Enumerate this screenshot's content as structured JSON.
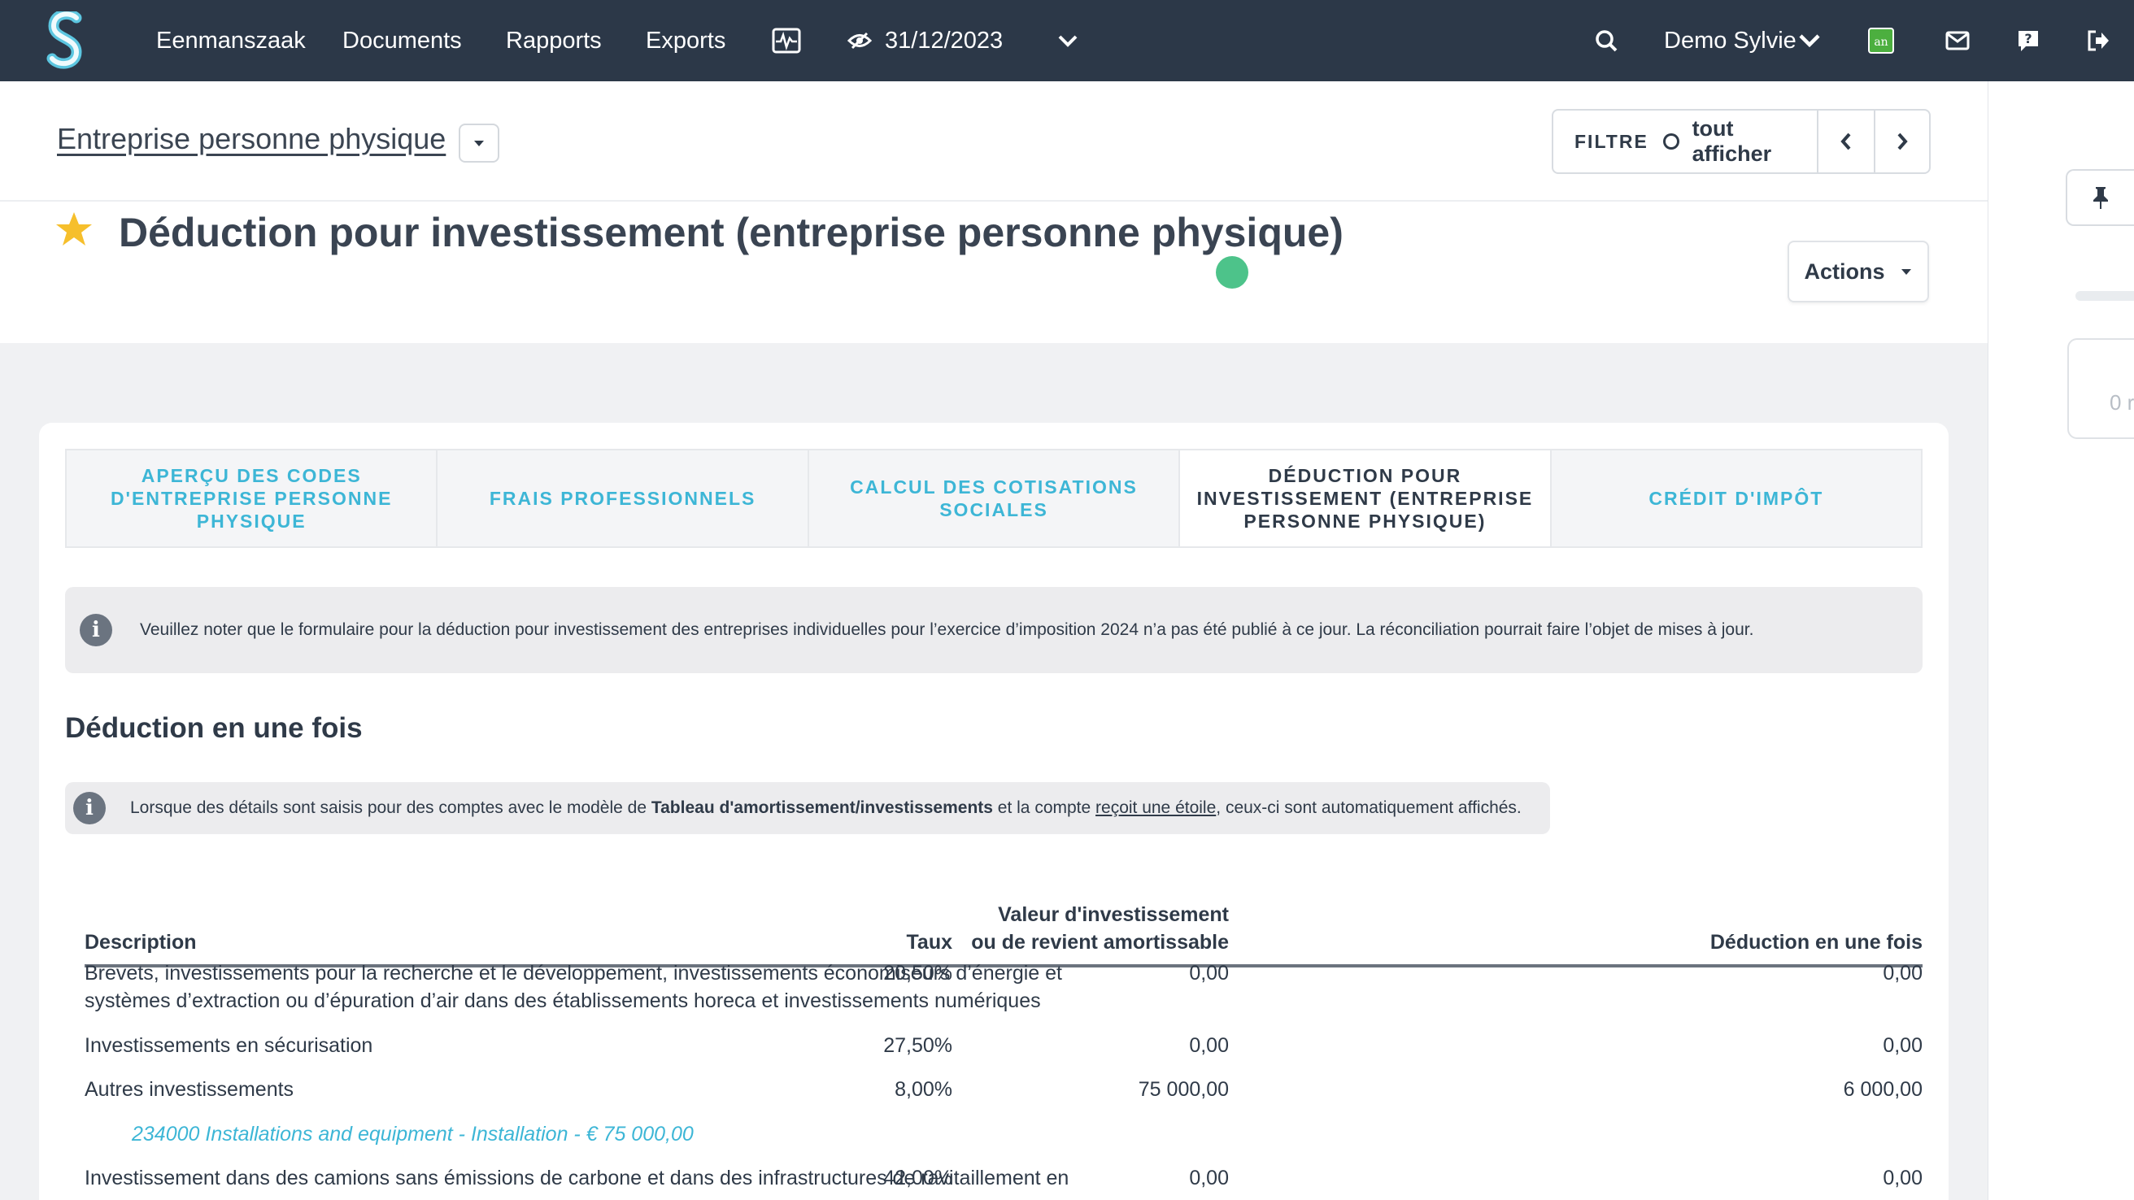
{
  "nav": {
    "items": [
      "Eenmanszaak",
      "Documents",
      "Rapports",
      "Exports"
    ],
    "date": "31/12/2023",
    "user": "Demo Sylvie"
  },
  "header": {
    "entity": "Entreprise personne physique",
    "filter_label": "FILTRE",
    "filter_value": "tout afficher",
    "page_title": "Déduction pour investissement (entreprise personne physique)",
    "actions_label": "Actions",
    "status_color": "#4dc38a"
  },
  "side": {
    "card_text": "0 r"
  },
  "tabs": [
    {
      "label": "Aperçu des codes d'entreprise personne physique",
      "active": false
    },
    {
      "label": "Frais professionnels",
      "active": false
    },
    {
      "label": "Calcul des cotisations sociales",
      "active": false
    },
    {
      "label": "Déduction pour investissement (entreprise personne physique)",
      "active": true
    },
    {
      "label": "Crédit d'impôt",
      "active": false
    }
  ],
  "notice": "Veuillez noter que le formulaire pour la déduction pour investissement des entreprises individuelles pour l’exercice d’imposition 2024 n’a pas été publié à ce jour. La réconciliation pourrait faire l’objet de mises à jour.",
  "section": {
    "title": "Déduction en une fois",
    "hint_prefix": "Lorsque des détails sont saisis pour des comptes avec le modèle de ",
    "hint_bold": "Tableau d'amortissement/investissements",
    "hint_mid": " et la compte ",
    "hint_link": "reçoit une étoile",
    "hint_suffix": ", ceux-ci sont automatiquement affichés."
  },
  "table": {
    "headers": {
      "description": "Description",
      "rate": "Taux",
      "value_line1": "Valeur d'investissement",
      "value_line2": "ou de revient amortissable",
      "deduction": "Déduction en une fois"
    },
    "rows": [
      {
        "description": "Brevets, investissements pour la recherche et le développement, investissements économiseurs d’énergie et systèmes d’extraction ou d’épuration d’air dans des établissements horeca et investissements numériques",
        "rate": "20,50%",
        "value": "0,00",
        "deduction": "0,00"
      },
      {
        "description": "Investissements en sécurisation",
        "rate": "27,50%",
        "value": "0,00",
        "deduction": "0,00"
      },
      {
        "description": "Autres investissements",
        "rate": "8,00%",
        "value": "75 000,00",
        "deduction": "6 000,00"
      },
      {
        "description": "Investissement dans des camions sans émissions de carbone et dans des infrastructures de ravitaillement en",
        "rate": "42,00%",
        "value": "0,00",
        "deduction": "0,00"
      }
    ],
    "sub_item": "234000 Installations and equipment - Installation - € 75 000,00"
  }
}
